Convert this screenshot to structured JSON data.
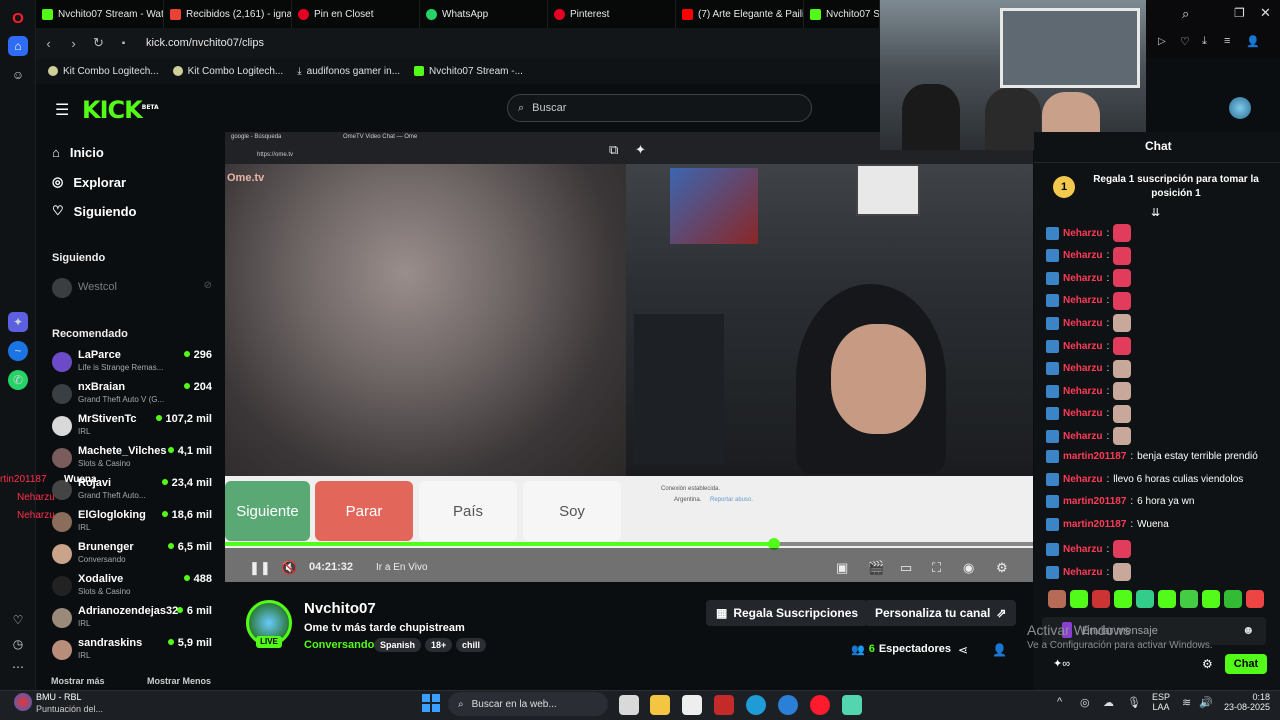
{
  "browser": {
    "tabs": [
      {
        "label": "Nvchito07 Stream - Watch",
        "color": "#53fc18"
      },
      {
        "label": "Recibidos (2,161) - ignaci",
        "color": "#ea4335"
      },
      {
        "label": "Pin en Closet",
        "color": "#e60023"
      },
      {
        "label": "WhatsApp",
        "color": "#25d366"
      },
      {
        "label": "Pinterest",
        "color": "#e60023"
      },
      {
        "label": "(7) Arte Elegante & Pailita",
        "color": "#ff0000"
      },
      {
        "label": "Nvchito07 Stream",
        "color": "#53fc18"
      }
    ],
    "url": "kick.com/nvchito07/clips",
    "bookmarks": [
      "Kit Combo Logitech...",
      "Kit Combo Logitech...",
      "audifonos gamer in...",
      "Nvchito07 Stream -..."
    ]
  },
  "kick": {
    "logo": "KICK",
    "logo_beta": "BETA",
    "search_placeholder": "Buscar",
    "nav": {
      "inicio": "Inicio",
      "explorar": "Explorar",
      "siguiendo": "Siguiendo"
    },
    "following_title": "Siguiendo",
    "following": [
      {
        "name": "Westcol"
      }
    ],
    "recommended_title": "Recomendado",
    "recommended": [
      {
        "name": "LaParce",
        "game": "Life is Strange Remas...",
        "viewers": "296",
        "color": "#6c4bc9"
      },
      {
        "name": "nxBraian",
        "game": "Grand Theft Auto V (G...",
        "viewers": "204",
        "color": "#3a3f44"
      },
      {
        "name": "MrStivenTc",
        "game": "IRL",
        "viewers": "107,2 mil",
        "color": "#d9d9d9"
      },
      {
        "name": "Machete_Vilches",
        "game": "Slots & Casino",
        "viewers": "4,1 mil",
        "color": "#7a5c5c"
      },
      {
        "name": "Rojavi",
        "game": "Grand Theft Auto...",
        "viewers": "23,4 mil",
        "color": "#444"
      },
      {
        "name": "ElGlogloking",
        "game": "IRL",
        "viewers": "18,6 mil",
        "color": "#8a6d5a"
      },
      {
        "name": "Brunenger",
        "game": "Conversando",
        "viewers": "6,5 mil",
        "color": "#c9a38a"
      },
      {
        "name": "Xodalive",
        "game": "Slots & Casino",
        "viewers": "488",
        "color": "#222"
      },
      {
        "name": "Adrianozendejas32",
        "game": "IRL",
        "viewers": "6 mil",
        "color": "#9a8a7a"
      },
      {
        "name": "sandraskins",
        "game": "IRL",
        "viewers": "5,9 mil",
        "color": "#b88e7a"
      }
    ],
    "show_more": "Mostrar más",
    "show_less": "Mostrar Menos",
    "overlay_chat": [
      "rtin201187",
      "Wuena",
      "Neharzu",
      "Neharzu"
    ]
  },
  "video": {
    "inner_tabs": [
      "google - Búsqueda",
      "OmeTV Video Chat — Ome"
    ],
    "inner_url": "https://ome.tv",
    "ome_logo": "Ome.tv",
    "buttons": {
      "next": "Siguiente",
      "stop": "Parar",
      "country": "País",
      "soy": "Soy"
    },
    "connection": {
      "line1": "Conexión establecida.",
      "line2": "Argentina.",
      "report": "Reportar abuso."
    },
    "time": "04:21:32",
    "go_live": "Ir a En Vivo",
    "progress": 0.68
  },
  "channel": {
    "name": "Nvchito07",
    "title": "Ome tv más tarde chupistream",
    "category": "Conversando",
    "tags": [
      "Spanish",
      "18+",
      "chill"
    ],
    "live_badge": "LIVE",
    "gift_subs": "Regala Suscripciones",
    "customize": "Personaliza tu canal",
    "viewers_count": "6",
    "viewers_label": "Espectadores"
  },
  "chat": {
    "title": "Chat",
    "gift_rank": "1",
    "gift_text": "Regala 1 suscripción para tomar la posición 1",
    "messages": [
      {
        "user": "Neharzu",
        "text": "",
        "emote": "#e23c5c"
      },
      {
        "user": "Neharzu",
        "text": "",
        "emote": "#e23c5c"
      },
      {
        "user": "Neharzu",
        "text": "",
        "emote": "#e23c5c"
      },
      {
        "user": "Neharzu",
        "text": "",
        "emote": "#e23c5c"
      },
      {
        "user": "Neharzu",
        "text": "",
        "emote": "#c8a89a"
      },
      {
        "user": "Neharzu",
        "text": "",
        "emote": "#e23c5c"
      },
      {
        "user": "Neharzu",
        "text": "",
        "emote": "#c8a89a"
      },
      {
        "user": "Neharzu",
        "text": "",
        "emote": "#c8a89a"
      },
      {
        "user": "Neharzu",
        "text": "",
        "emote": "#c8a89a"
      },
      {
        "user": "Neharzu",
        "text": "",
        "emote": "#c8a89a"
      },
      {
        "user": "martin201187",
        "text": "benja estay terrible prendió",
        "emote": ""
      },
      {
        "user": "Neharzu",
        "text": "llevo 6 horas culias viendolos",
        "emote": ""
      },
      {
        "user": "martin201187",
        "text": "6 hora ya wn",
        "emote": ""
      },
      {
        "user": "martin201187",
        "text": "Wuena",
        "emote": ""
      },
      {
        "user": "Neharzu",
        "text": "",
        "emote": "#e23c5c"
      },
      {
        "user": "Neharzu",
        "text": "",
        "emote": "#c8a89a"
      }
    ],
    "input_placeholder": "Enviar mensaje",
    "send": "Chat",
    "activate_title": "Activar Windows",
    "activate_sub": "Ve a Configuración para activar Windows."
  },
  "taskbar": {
    "weather_title": "BMU - RBL",
    "weather_sub": "Puntuación del...",
    "search": "Buscar en la web...",
    "lang1": "ESP",
    "lang2": "LAA",
    "time": "0:18",
    "date": "23-08-2025"
  }
}
